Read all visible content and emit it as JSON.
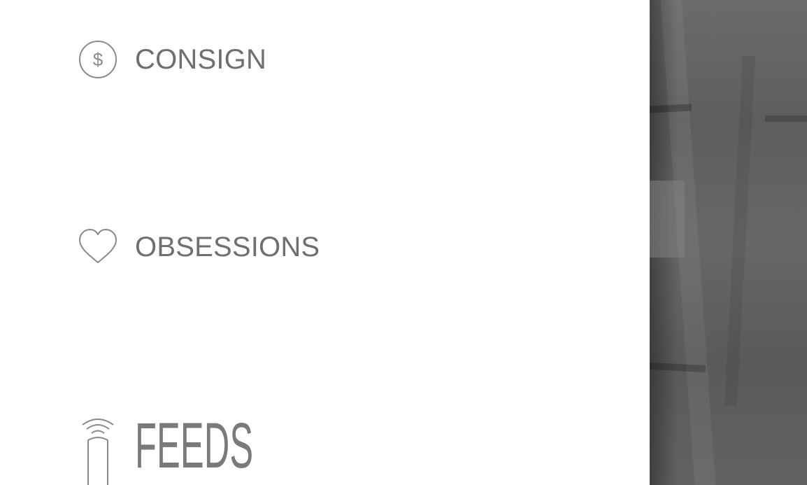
{
  "menu": {
    "items": [
      {
        "label": "CONSIGN",
        "icon": "dollar-circle-icon"
      },
      {
        "label": "OBSESSIONS",
        "icon": "heart-icon"
      },
      {
        "label": "FEEDS",
        "icon": "feeds-icon"
      }
    ]
  },
  "colors": {
    "text": "#6f6f6f",
    "icon": "#8a8a8a",
    "background": "#ffffff",
    "overlay": "#626262"
  }
}
